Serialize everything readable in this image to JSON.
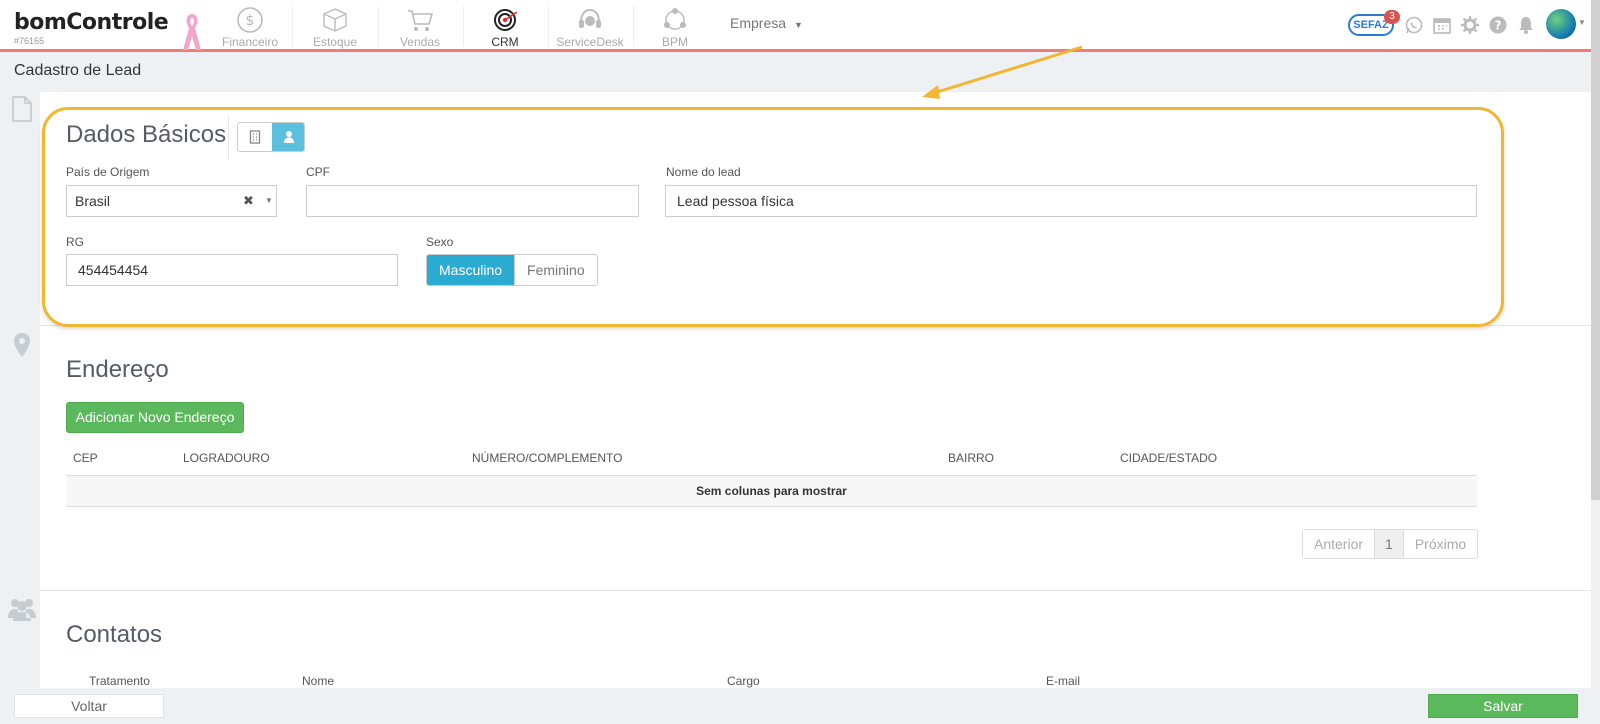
{
  "header": {
    "logo": "bomControle",
    "account_id": "#76165",
    "nav": [
      {
        "label": "Financeiro",
        "icon": "dollar-circle-icon"
      },
      {
        "label": "Estoque",
        "icon": "box-icon"
      },
      {
        "label": "Vendas",
        "icon": "cart-icon"
      },
      {
        "label": "CRM",
        "icon": "target-icon"
      },
      {
        "label": "ServiceDesk",
        "icon": "headset-icon"
      },
      {
        "label": "BPM",
        "icon": "network-icon"
      }
    ],
    "company_menu": "Empresa",
    "sefaz_label": "SEFAZ",
    "sefaz_count": "3"
  },
  "page": {
    "title": "Cadastro de Lead"
  },
  "dados_basicos": {
    "title": "Dados Básicos",
    "pais_label": "País de Origem",
    "pais_value": "Brasil",
    "cpf_label": "CPF",
    "cpf_value": "",
    "nome_label": "Nome do lead",
    "nome_value": "Lead pessoa física",
    "rg_label": "RG",
    "rg_value": "454454454",
    "sexo_label": "Sexo",
    "sexo_options": [
      "Masculino",
      "Feminino"
    ],
    "sexo_selected": "Masculino"
  },
  "endereco": {
    "title": "Endereço",
    "add_button": "Adicionar Novo Endereço",
    "columns": [
      "CEP",
      "LOGRADOURO",
      "NÚMERO/COMPLEMENTO",
      "BAIRRO",
      "CIDADE/ESTADO"
    ],
    "empty_message": "Sem colunas para mostrar",
    "pager": {
      "prev": "Anterior",
      "page": "1",
      "next": "Próximo"
    }
  },
  "contatos": {
    "title": "Contatos",
    "columns": [
      "Tratamento",
      "Nome",
      "Cargo",
      "E-mail"
    ]
  },
  "footer": {
    "back_label": "Voltar",
    "save_label": "Salvar"
  },
  "colors": {
    "accent_blue": "#2aabd2",
    "green": "#5cb85c",
    "highlight": "#f2b731",
    "topbar_border": "#ef7b7b"
  }
}
